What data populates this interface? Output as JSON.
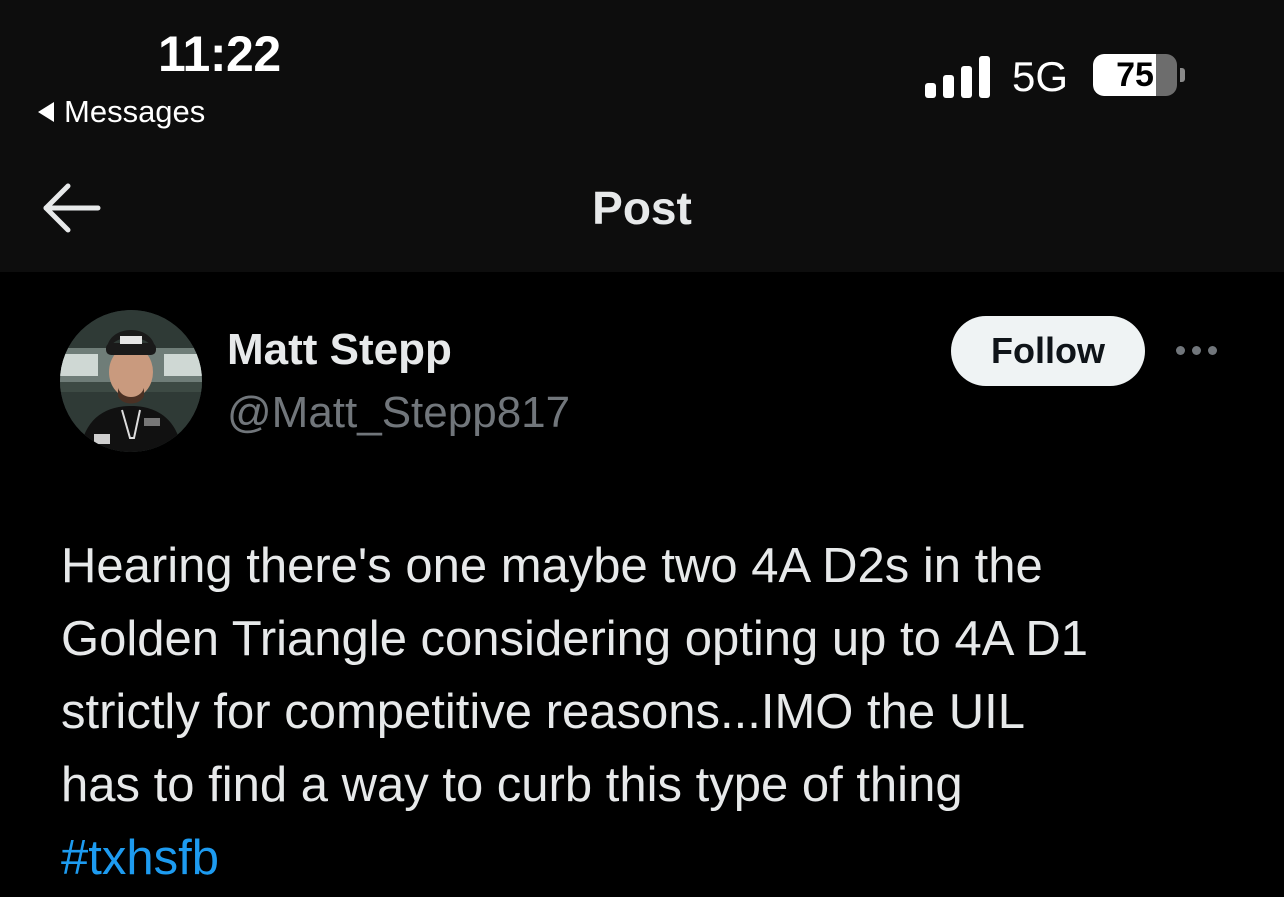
{
  "status_bar": {
    "time": "11:22",
    "back_app": "Messages",
    "network": "5G",
    "battery_level": 75,
    "battery_text": "75",
    "signal_bars": 4
  },
  "nav": {
    "title": "Post",
    "back_icon": "arrow-left-icon"
  },
  "post": {
    "author": {
      "name": "Matt Stepp",
      "handle": "@Matt_Stepp817"
    },
    "follow_label": "Follow",
    "more_icon": "ellipsis-icon",
    "text_lines": [
      "Hearing there's one maybe two 4A D2s in the",
      "Golden Triangle considering opting up to 4A D1",
      "strictly for competitive reasons...IMO the UIL",
      "has to find a way to curb this type of thing"
    ],
    "hashtag": "#txhsfb"
  },
  "colors": {
    "background": "#000000",
    "header_background": "#0d0d0d",
    "text_primary": "#e7e9ea",
    "text_secondary": "#71767b",
    "link": "#1d9bf0",
    "follow_button_bg": "#eff3f4"
  }
}
